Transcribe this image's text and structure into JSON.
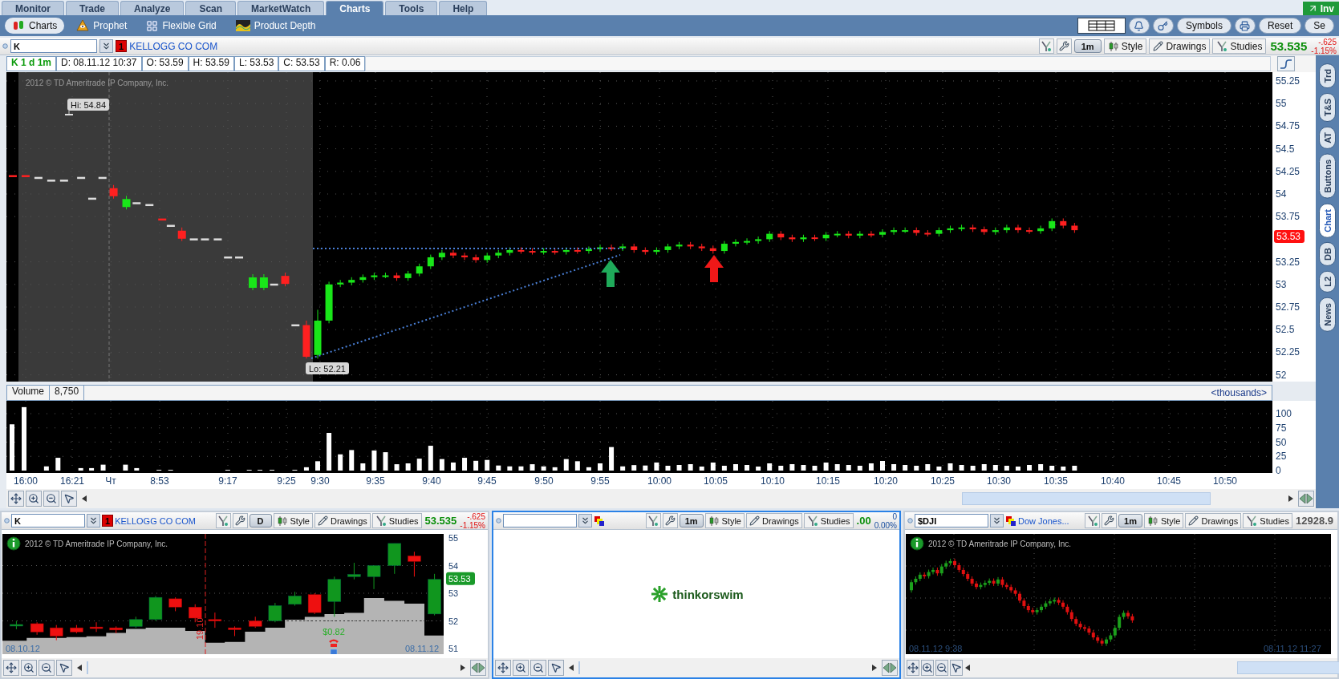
{
  "menu_tabs": [
    {
      "label": "Monitor",
      "selected": false
    },
    {
      "label": "Trade",
      "selected": false
    },
    {
      "label": "Analyze",
      "selected": false
    },
    {
      "label": "Scan",
      "selected": false
    },
    {
      "label": "MarketWatch",
      "selected": false
    },
    {
      "label": "Charts",
      "selected": true
    },
    {
      "label": "Tools",
      "selected": false
    },
    {
      "label": "Help",
      "selected": false
    }
  ],
  "corner_button": "Inv",
  "sub_tabs": [
    {
      "label": "Charts",
      "selected": true
    },
    {
      "label": "Prophet",
      "selected": false
    },
    {
      "label": "Flexible Grid",
      "selected": false
    },
    {
      "label": "Product Depth",
      "selected": false
    }
  ],
  "toolbar_buttons": [
    "Symbols",
    "Reset",
    "Se"
  ],
  "main_chart": {
    "header": {
      "symbol": "K",
      "badge": "1",
      "description": "KELLOGG CO COM",
      "aggregation": "1m",
      "buttons": [
        "Style",
        "Drawings",
        "Studies"
      ],
      "last": "53.535",
      "last_up": true,
      "change": "-.625",
      "change_pct": "-1.15%",
      "negative": true
    },
    "info_title": "K 1 d 1m",
    "info": [
      "D: 08.11.12 10:37",
      "O: 53.59",
      "H: 53.59",
      "L: 53.53",
      "C: 53.53",
      "R: 0.06"
    ],
    "copyright": "2012 © TD Ameritrade IP Company, Inc.",
    "hi_label": "Hi: 54.84",
    "lo_label": "Lo: 52.21",
    "price_ticks": [
      "55.25",
      "55",
      "54.75",
      "54.5",
      "54.25",
      "54",
      "53.75",
      "53.25",
      "53",
      "52.75",
      "52.5",
      "52.25",
      "52"
    ],
    "current_price": "53.53",
    "volume": {
      "label": "Volume",
      "value": "8,750",
      "units": "<thousands>",
      "ticks": [
        "100",
        "75",
        "50",
        "25",
        "0"
      ]
    },
    "time_ticks": [
      "16:00",
      "16:21",
      "Чт",
      "8:53",
      "9:17",
      "9:25",
      "9:30",
      "9:35",
      "9:40",
      "9:45",
      "9:50",
      "9:55",
      "10:00",
      "10:05",
      "10:10",
      "10:15",
      "10:20",
      "10:25",
      "10:30",
      "10:35",
      "10:40",
      "10:45",
      "10:50"
    ]
  },
  "side_tabs": [
    {
      "label": "Trd",
      "selected": false
    },
    {
      "label": "T&S",
      "selected": false
    },
    {
      "label": "AT",
      "selected": false
    },
    {
      "label": "Buttons",
      "selected": false
    },
    {
      "label": "Chart",
      "selected": true
    },
    {
      "label": "DB",
      "selected": false
    },
    {
      "label": "L2",
      "selected": false
    },
    {
      "label": "News",
      "selected": false
    }
  ],
  "bottom_panels": [
    {
      "kind": "daily_chart",
      "selected": false,
      "header": {
        "symbol": "K",
        "badge": "1",
        "description": "KELLOGG CO COM",
        "aggregation": "D",
        "buttons": [
          "Style",
          "Drawings",
          "Studies"
        ],
        "last": "53.535",
        "last_up": true,
        "change": "-.625",
        "change_pct": "-1.15%",
        "negative": true
      },
      "copyright": "2012 © TD Ameritrade IP Company, Inc.",
      "price_ticks": [
        "55",
        "54",
        "53",
        "52",
        "51"
      ],
      "current_price": "53.53",
      "event_label": "$0.82",
      "date_marker": "19.10",
      "start_date": "08.10.12",
      "end_date": "08.11.12"
    },
    {
      "kind": "empty",
      "selected": true,
      "header": {
        "aggregation": "1m",
        "buttons": [
          "Style",
          "Drawings",
          "Studies"
        ],
        "last": ".00",
        "last_up": true,
        "change": "0",
        "change_pct": "0.00%",
        "negative": false
      },
      "logo": "thinkorswim"
    },
    {
      "kind": "intraday_chart",
      "selected": false,
      "header": {
        "symbol": "$DJI",
        "description": "Dow Jones...",
        "aggregation": "1m",
        "buttons": [
          "Style",
          "Drawings",
          "Studies"
        ],
        "last": "12928.9",
        "last_up": false
      },
      "copyright": "2012 © TD Ameritrade IP Company, Inc.",
      "start_date": "08.11.12 9:38",
      "end_date": "08.11.12 11:27"
    }
  ]
}
